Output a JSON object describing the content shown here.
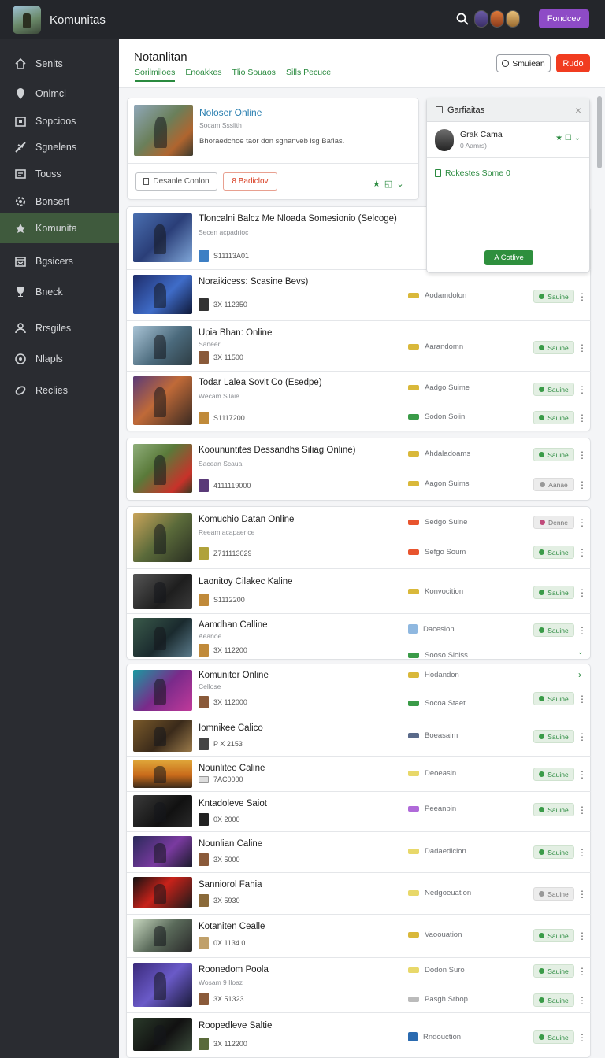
{
  "app": {
    "title": "Komunitas",
    "top_button": "Fondcev"
  },
  "sidebar": {
    "items": [
      {
        "label": "Senits",
        "icon": "home-icon"
      },
      {
        "label": "Onlmcl",
        "icon": "pin-icon"
      },
      {
        "label": "Sopcioos",
        "icon": "box-icon"
      },
      {
        "label": "Sgnelens",
        "icon": "plane-icon"
      },
      {
        "label": "Touss",
        "icon": "list-icon"
      },
      {
        "label": "Bonsert",
        "icon": "gear-icon"
      },
      {
        "label": "Komunita",
        "icon": "game-icon"
      },
      {
        "label": "Bgsicers",
        "icon": "calendar-icon"
      },
      {
        "label": "Bneck",
        "icon": "trophy-icon"
      },
      {
        "label": "Rrsgiles",
        "icon": "users-icon"
      },
      {
        "label": "Nlapls",
        "icon": "target-icon"
      },
      {
        "label": "Reclies",
        "icon": "ring-icon"
      }
    ]
  },
  "header": {
    "title": "Notanlitan",
    "tabs": [
      "Sorilmiloes",
      "Enoakkes",
      "Tlio Souaos",
      "Sills Pecuce"
    ],
    "outline_button": "Smuiean",
    "red_button": "Rudo"
  },
  "featured": {
    "title": "Noloser Online",
    "subtitle": "Socam Ssslith",
    "description": "Bhoraedchoe taor don sgnanveb lsg Bafias.",
    "button1": "Desanle Conlon",
    "button2": "8 Badiclov"
  },
  "panel": {
    "title": "Garfiaitas",
    "user_name": "Grak Cama",
    "user_sub": "0 Aamrs)",
    "link": "Rokestes Some 0",
    "button": "A Cotlive"
  },
  "rows": [
    {
      "title": "Tloncalni Balcz Me Nloada Somesionio (Selcoge)",
      "sub": "Secen acpadrioc",
      "meta": "S11113A01"
    },
    {
      "title": "Noraikicess: Scasine Bevs)",
      "sub": "",
      "meta": "3X 112350",
      "status": "Aodamdolon",
      "pill": "Sauine"
    },
    {
      "title": "Upia Bhan: Online",
      "sub": "Saneer",
      "meta": "3X 11500",
      "status": "Aarandomn",
      "pill": "Sauine"
    },
    {
      "title": "Todar Lalea Sovit Co (Esedpe)",
      "sub": "Wecam Silaie",
      "meta": "S1117200",
      "status": "Aadgo Suime",
      "status2": "Sodon Soiin",
      "pill": "Sauine",
      "pill2": "Sauine"
    },
    {
      "title": "Kooununtites Dessandhs Siliag Online)",
      "sub": "Sacean Scaua",
      "meta": "4111119000",
      "status": "Ahdaladoams",
      "status2": "Aagon Suims",
      "pill": "Sauine",
      "pill2": "Aanae"
    },
    {
      "title": "Komuchio Datan Online",
      "sub": "Reeam acapaerice",
      "meta": "Z711113029",
      "status": "Sedgo Suine",
      "status2": "Sefgo Soum",
      "pill": "Denne",
      "pill2": "Sauine"
    },
    {
      "title": "Laonitoy Cilakec Kaline",
      "sub": "",
      "meta": "S1112200",
      "status": "Konvocition",
      "pill": "Sauine"
    },
    {
      "title": "Aamdhan Calline",
      "sub": "Aeanoe",
      "meta": "3X 112200",
      "status": "Dacesion",
      "status2": "Sooso Sloiss",
      "pill": "Sauine"
    },
    {
      "title": "Komuniter Online",
      "sub": "Cellose",
      "meta": "3X 112000",
      "status": "Hodandon",
      "status2": "Socoa Staet",
      "pill": "Sauine"
    },
    {
      "title": "Iomnikee Calico",
      "sub": "",
      "meta": "P X 2153",
      "status": "Boeasaim",
      "pill": "Sauine"
    },
    {
      "title": "Nounlitee Caline",
      "sub": "",
      "meta": "7AC0000",
      "status": "Deoeasin",
      "pill": "Sauine"
    },
    {
      "title": "Kntadoleve Saiot",
      "sub": "",
      "meta": "0X 2000",
      "status": "Peeanbin",
      "pill": "Sauine"
    },
    {
      "title": "Nounlian Caline",
      "sub": "",
      "meta": "3X 5000",
      "status": "Dadaedicion",
      "pill": "Sauine"
    },
    {
      "title": "Sanniorol Fahia",
      "sub": "",
      "meta": "3X 5930",
      "status": "Nedgoeuation",
      "pill": "Sauine"
    },
    {
      "title": "Kotaniten Cealle",
      "sub": "",
      "meta": "0X 1134 0",
      "status": "Vaoouation",
      "pill": "Sauine"
    },
    {
      "title": "Roonedom Poola",
      "sub": "Wosam 9 Iloaz",
      "meta": "3X 51323",
      "status": "Dodon Suro",
      "status2": "Pasgh Srbop",
      "pill": "Sauine",
      "pill2": "Sauine"
    },
    {
      "title": "Roopedleve Saltie",
      "sub": "",
      "meta": "3X 112200",
      "status": "Rndouction",
      "pill": "Sauine"
    }
  ],
  "colors": {
    "accent": "#2a8a3f",
    "brand_purple": "#8e4bc6",
    "danger": "#f13c20",
    "sidebar": "#2a2c31"
  }
}
